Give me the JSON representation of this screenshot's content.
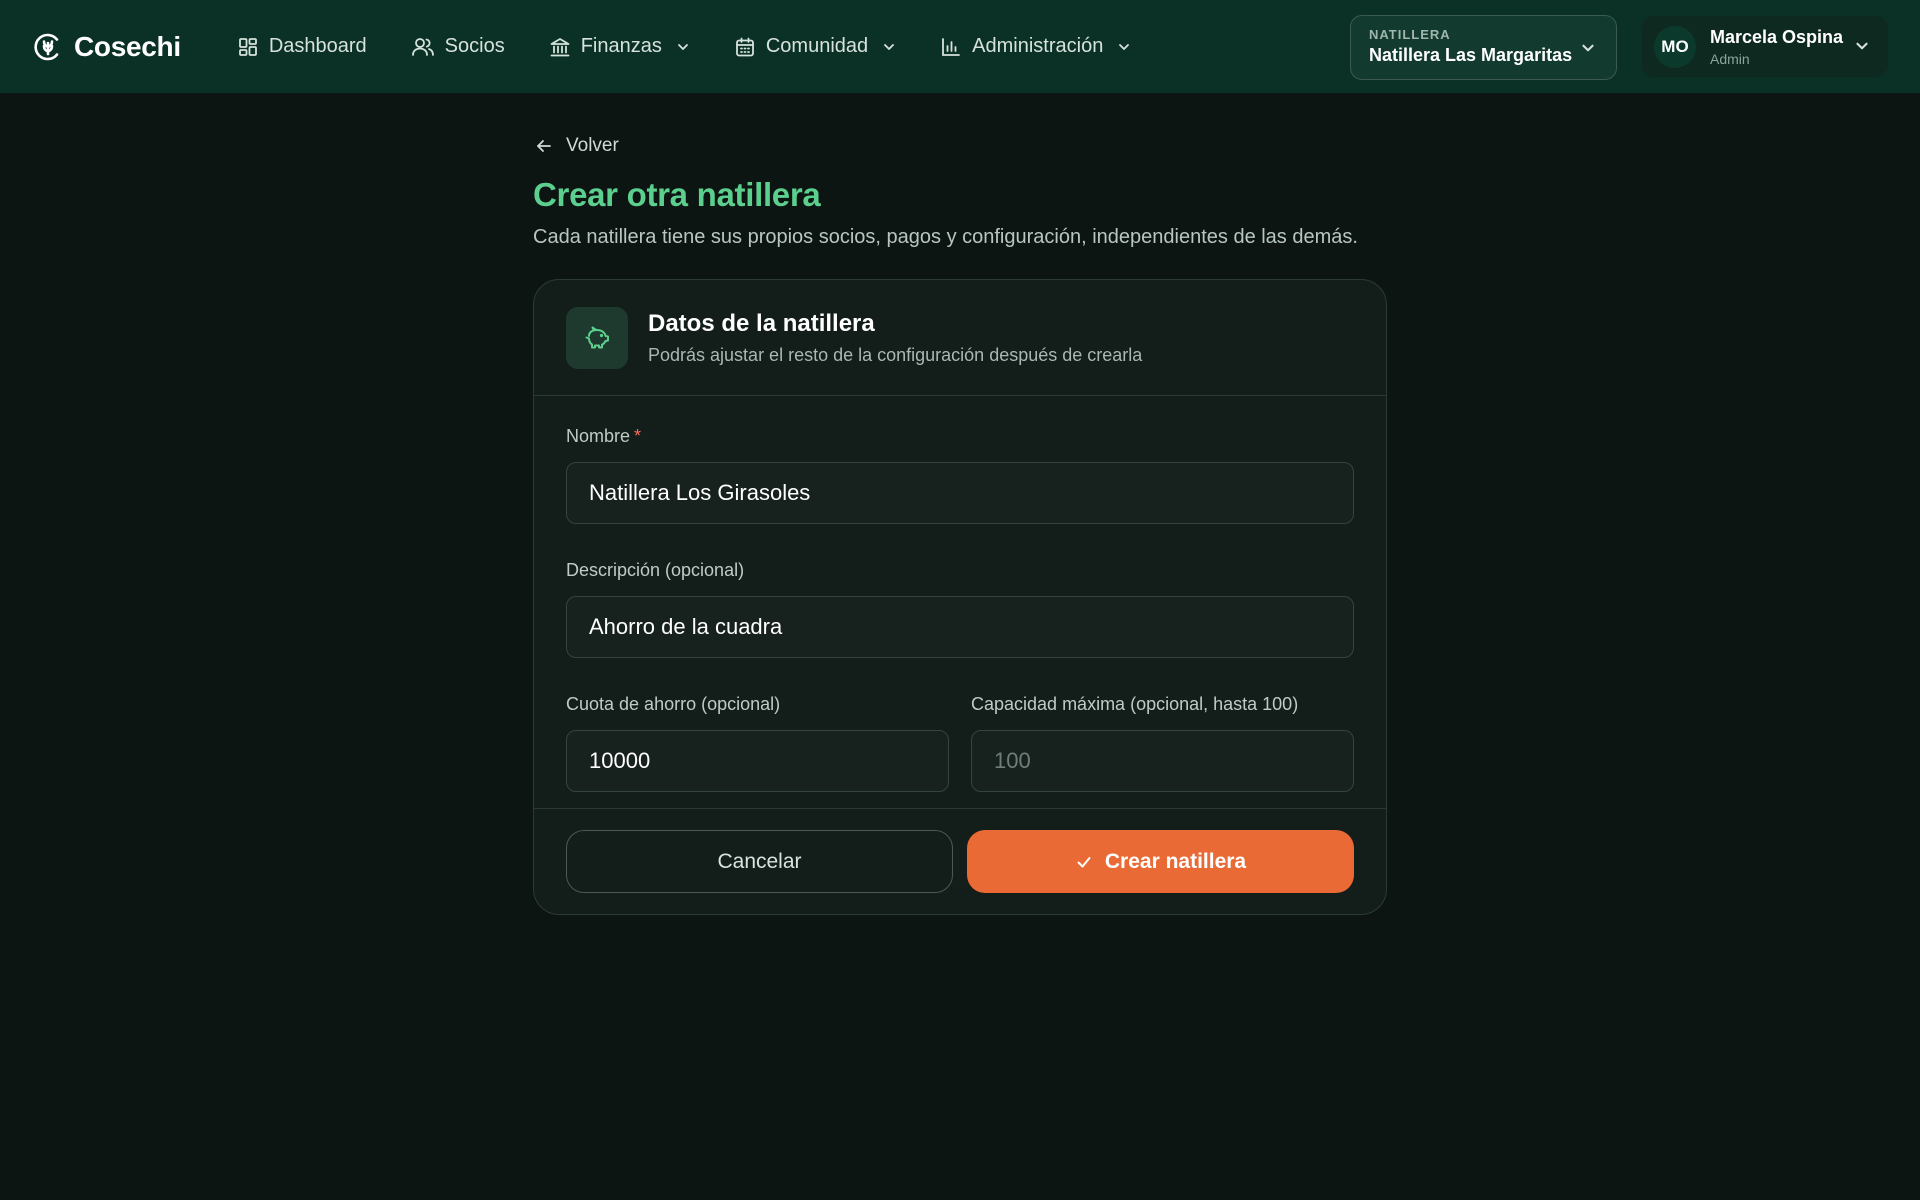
{
  "brand": {
    "name": "Cosechi",
    "icon": "wheat-logo-icon"
  },
  "nav": {
    "items": [
      {
        "label": "Dashboard",
        "icon": "dashboard-grid-icon",
        "has_dropdown": false
      },
      {
        "label": "Socios",
        "icon": "users-icon",
        "has_dropdown": false
      },
      {
        "label": "Finanzas",
        "icon": "bank-icon",
        "has_dropdown": true
      },
      {
        "label": "Comunidad",
        "icon": "calendar-icon",
        "has_dropdown": true
      },
      {
        "label": "Administración",
        "icon": "bar-chart-icon",
        "has_dropdown": true
      }
    ]
  },
  "org_switcher": {
    "label": "NATILLERA",
    "name": "Natillera Las Margaritas"
  },
  "user": {
    "initials": "MO",
    "name": "Marcela Ospina",
    "role": "Admin"
  },
  "page": {
    "back_label": "Volver",
    "title": "Crear otra natillera",
    "subtitle": "Cada natillera tiene sus propios socios, pagos y configuración, independientes de las demás."
  },
  "card": {
    "icon": "piggy-bank-icon",
    "title": "Datos de la natillera",
    "subtitle": "Podrás ajustar el resto de la configuración después de crearla"
  },
  "form": {
    "name": {
      "label": "Nombre",
      "required_mark": "*",
      "value": "Natillera Los Girasoles"
    },
    "description": {
      "label": "Descripción (opcional)",
      "value": "Ahorro de la cuadra"
    },
    "quota": {
      "label": "Cuota de ahorro (opcional)",
      "value": "10000"
    },
    "capacity": {
      "label": "Capacidad máxima (opcional, hasta 100)",
      "value": "",
      "placeholder": "100"
    }
  },
  "actions": {
    "cancel_label": "Cancelar",
    "submit_label": "Crear natillera"
  },
  "colors": {
    "topbar": "#0b3025",
    "background": "#0c1512",
    "accent_green": "#5ccf8e",
    "primary_orange": "#e96a35",
    "required": "#ff6b5a"
  }
}
